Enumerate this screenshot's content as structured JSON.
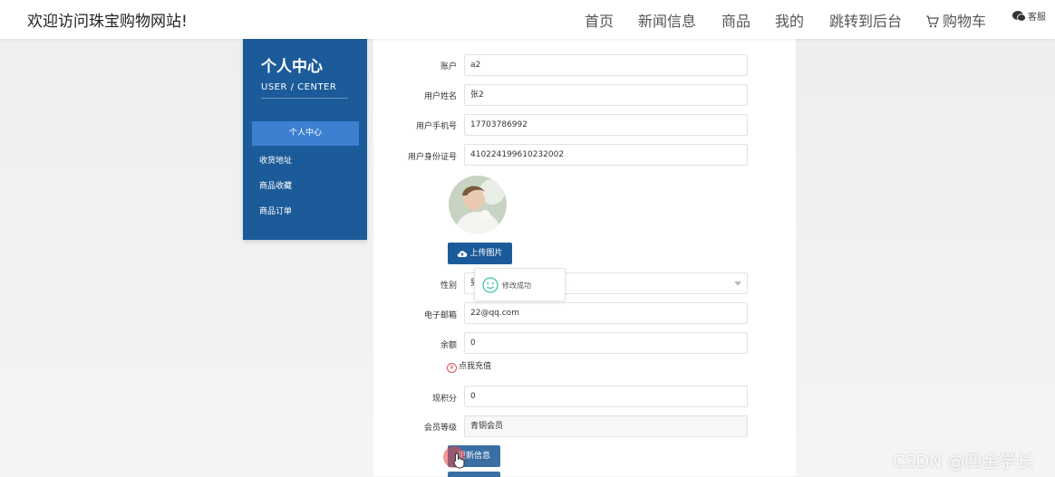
{
  "header": {
    "site_title": "欢迎访问珠宝购物网站!",
    "nav": [
      "首页",
      "新闻信息",
      "商品",
      "我的",
      "跳转到后台",
      "购物车"
    ],
    "service_label": "客服"
  },
  "sidebar": {
    "title": "个人中心",
    "subtitle": "USER / CENTER",
    "active_item": "个人中心",
    "items": [
      "收货地址",
      "商品收藏",
      "商品订单"
    ]
  },
  "form": {
    "account": {
      "label": "账户",
      "value": "a2"
    },
    "name": {
      "label": "用户姓名",
      "value": "张2"
    },
    "phone": {
      "label": "用户手机号",
      "value": "17703786992"
    },
    "idcard": {
      "label": "用户身份证号",
      "value": "410224199610232002"
    },
    "upload_label": "上传图片",
    "gender": {
      "label": "性别",
      "value": "男"
    },
    "email": {
      "label": "电子邮箱",
      "value": "22@qq.com"
    },
    "balance": {
      "label": "余额",
      "value": "0"
    },
    "recharge_label": "点我充值",
    "points": {
      "label": "现积分",
      "value": "0"
    },
    "level": {
      "label": "会员等级",
      "value": "青铜会员"
    },
    "update_label": "更新信息"
  },
  "toast": {
    "text": "修改成功"
  },
  "watermark": "CSDN @四金学长",
  "colors": {
    "sidebar_bg": "#1c5b9a",
    "sidebar_active": "#3d7fd1",
    "primary_button": "#1c5b9a",
    "toast_icon": "#3cc6a8"
  }
}
